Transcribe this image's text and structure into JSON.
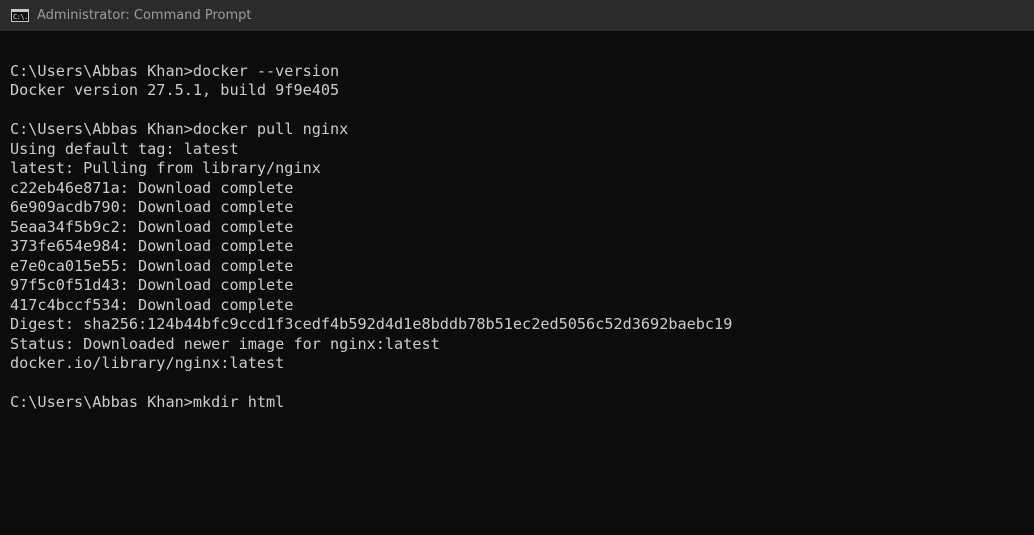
{
  "window": {
    "title": "Administrator: Command Prompt",
    "icon": "cmd-icon",
    "icon_text": "C:\\."
  },
  "console": {
    "lines": [
      "",
      "C:\\Users\\Abbas Khan>docker --version",
      "Docker version 27.5.1, build 9f9e405",
      "",
      "C:\\Users\\Abbas Khan>docker pull nginx",
      "Using default tag: latest",
      "latest: Pulling from library/nginx",
      "c22eb46e871a: Download complete",
      "6e909acdb790: Download complete",
      "5eaa34f5b9c2: Download complete",
      "373fe654e984: Download complete",
      "e7e0ca015e55: Download complete",
      "97f5c0f51d43: Download complete",
      "417c4bccf534: Download complete",
      "Digest: sha256:124b44bfc9ccd1f3cedf4b592d4d1e8bddb78b51ec2ed5056c52d3692baebc19",
      "Status: Downloaded newer image for nginx:latest",
      "docker.io/library/nginx:latest",
      "",
      "C:\\Users\\Abbas Khan>mkdir html"
    ]
  },
  "colors": {
    "background": "#0c0c0c",
    "text": "#cccccc",
    "titlebar": "#2b2b2b",
    "title_text": "#9b9b9b"
  }
}
